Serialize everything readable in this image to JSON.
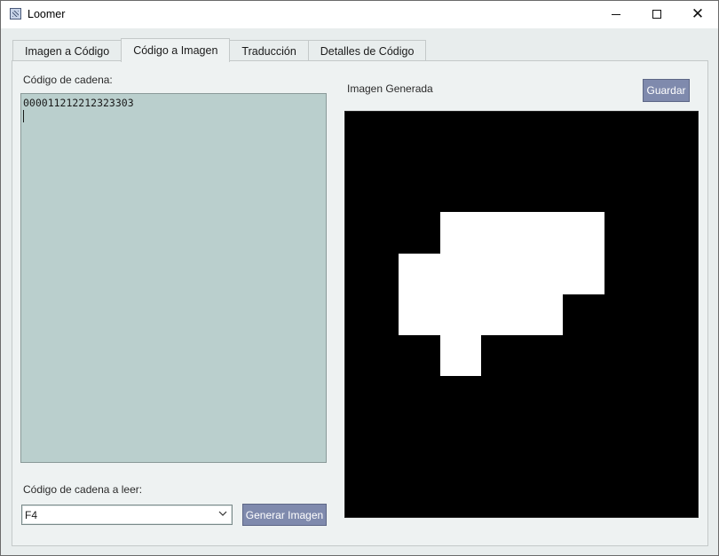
{
  "window": {
    "title": "Loomer",
    "icon": "loom-app-icon",
    "controls": {
      "minimize": "minimize-icon",
      "maximize": "maximize-icon",
      "close": "close-icon"
    }
  },
  "tabs": [
    {
      "label": "Imagen a Código",
      "active": false
    },
    {
      "label": "Código a Imagen",
      "active": true
    },
    {
      "label": "Traducción",
      "active": false
    },
    {
      "label": "Detalles de Código",
      "active": false
    }
  ],
  "left": {
    "chain_code_label": "Código de cadena:",
    "chain_code_value": "000011212212323303",
    "read_label": "Código de cadena a leer:",
    "read_select_value": "F4",
    "generate_button": "Generar Imagen"
  },
  "right": {
    "generated_label": "Imagen Generada",
    "save_button": "Guardar"
  },
  "colors": {
    "accent_button": "#7f8aad",
    "text_area_bg": "#bacfcd",
    "panel_bg": "#eef2f2",
    "image_bg": "#000000",
    "image_fg": "#ffffff"
  }
}
